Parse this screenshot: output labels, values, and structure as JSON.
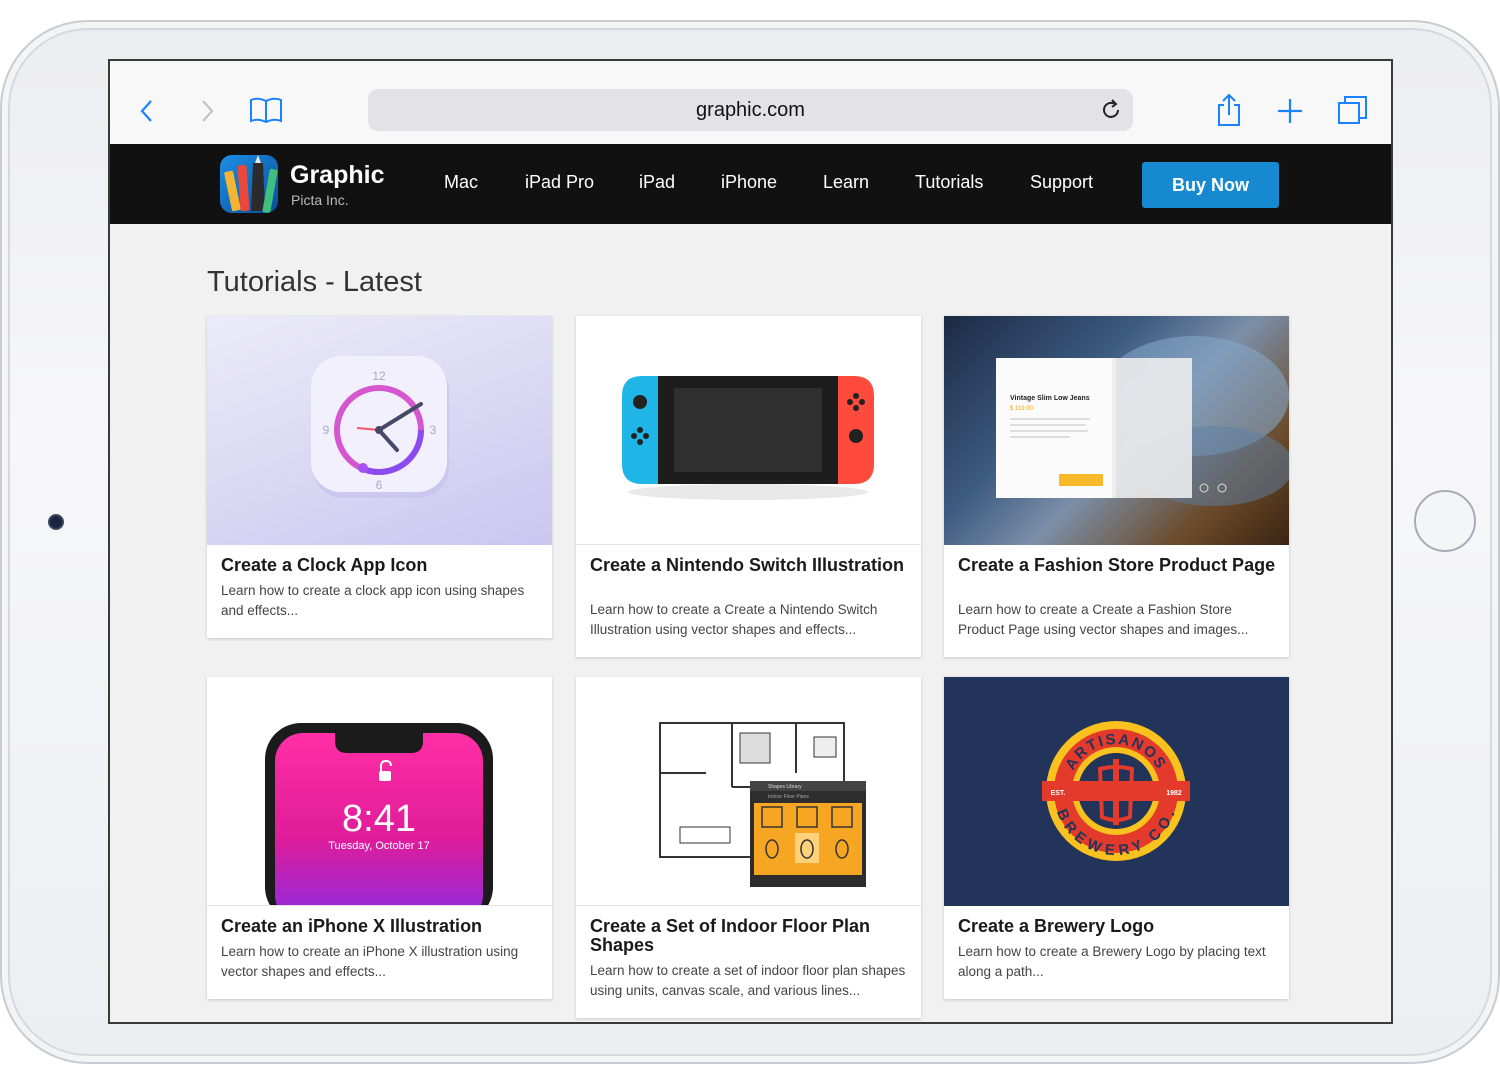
{
  "browser": {
    "url": "graphic.com"
  },
  "site": {
    "logo_title": "Graphic",
    "logo_subtitle": "Picta Inc.",
    "nav": [
      "Mac",
      "iPad Pro",
      "iPad",
      "iPhone",
      "Learn",
      "Tutorials",
      "Support"
    ],
    "buy_label": "Buy Now"
  },
  "page": {
    "title": "Tutorials - Latest"
  },
  "cards": [
    {
      "title": "Create a Clock App Icon",
      "desc": "Learn how to create a clock app icon using shapes and effects..."
    },
    {
      "title": "Create a Nintendo Switch Illustration",
      "desc": "Learn how to create a Create a Nintendo Switch Illustration using vector shapes and effects..."
    },
    {
      "title": "Create a Fashion Store Product Page",
      "desc": "Learn how to create a Create a Fashion Store Product Page using vector shapes and images..."
    },
    {
      "title": "Create an iPhone X Illustration",
      "desc": "Learn how to create an iPhone X illustration using vector shapes and effects..."
    },
    {
      "title": "Create a Set of Indoor Floor Plan Shapes",
      "desc": "Learn how to create a set of indoor floor plan shapes using units, canvas scale, and various lines..."
    },
    {
      "title": "Create a Brewery Logo",
      "desc": "Learn how to create a Brewery Logo by placing text along a path..."
    }
  ],
  "art": {
    "clock": {
      "n12": "12",
      "n3": "3",
      "n6": "6",
      "n9": "9"
    },
    "fashion": {
      "product": "Vintage Slim Low Jeans",
      "price": "$ 119.90"
    },
    "iphone": {
      "time": "8:41",
      "date": "Tuesday, October 17"
    },
    "floorplan": {
      "panel_title": "Shapes Library",
      "panel_sub": "Indoor Floor Plans"
    },
    "brewery": {
      "top": "ARTISANOS",
      "bottom": "BREWERY CO.",
      "left": "EST.",
      "right": "1982"
    }
  },
  "colors": {
    "accent": "#1689d0",
    "nav_bg": "#111111",
    "browser_tint": "#1a82ff"
  }
}
